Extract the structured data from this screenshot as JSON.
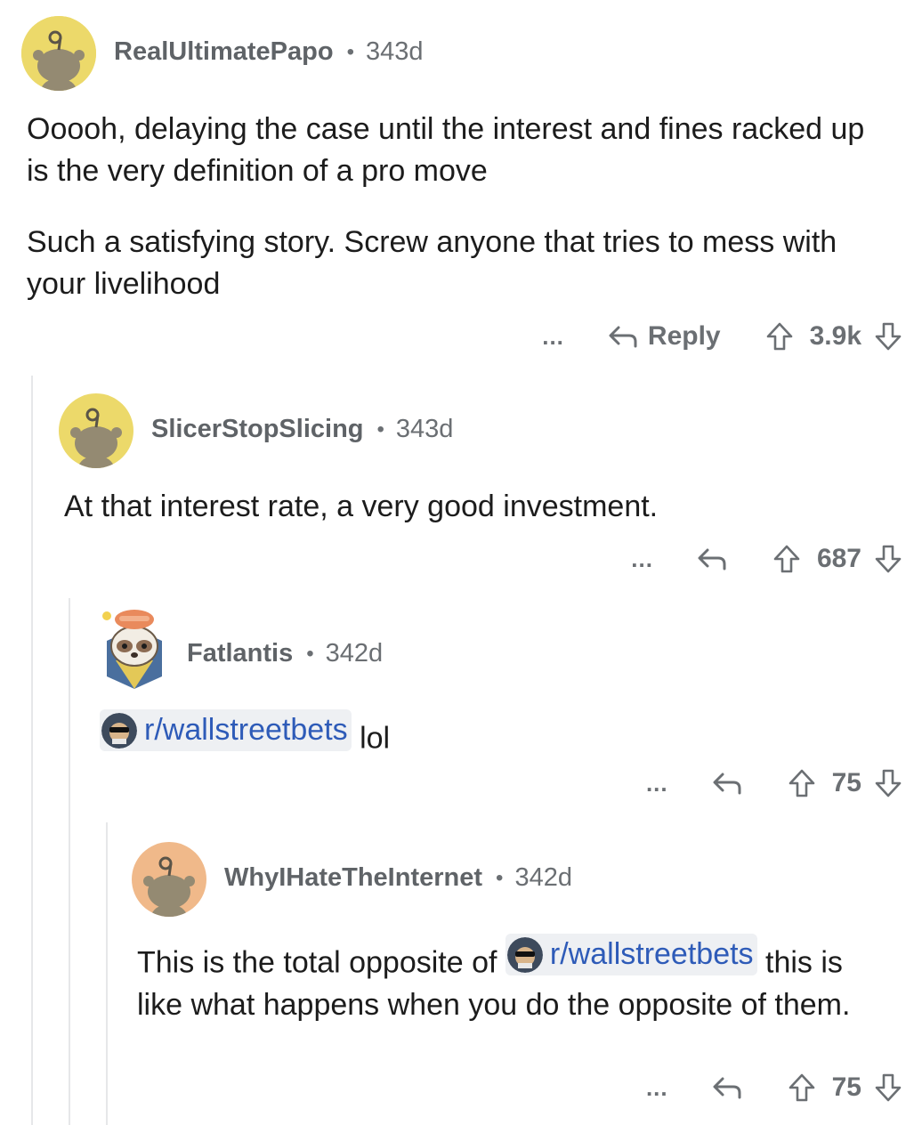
{
  "comments": [
    {
      "username": "RealUltimatePapo",
      "age": "343d",
      "paragraphs": [
        "Ooooh, delaying the case until the interest and fines racked up is the very definition of a pro move",
        "Such a satisfying story. Screw anyone that tries to mess with your livelihood"
      ],
      "more": "...",
      "reply_label": "Reply",
      "score": "3.9k"
    },
    {
      "username": "SlicerStopSlicing",
      "age": "343d",
      "text": "At that interest rate, a very good investment.",
      "more": "...",
      "score": "687"
    },
    {
      "username": "Fatlantis",
      "age": "342d",
      "subreddit_link": "r/wallstreetbets",
      "text_after": "lol",
      "more": "...",
      "score": "75"
    },
    {
      "username": "WhyIHateTheInternet",
      "age": "342d",
      "text_before": "This is the total opposite of",
      "subreddit_link": "r/wallstreetbets",
      "text_after": "this is like what happens when you do the opposite of them.",
      "more": "...",
      "score": "75"
    }
  ],
  "colors": {
    "avatar_yellow": "#ecd96a",
    "avatar_orange": "#f0b98a",
    "link": "#2e5bb8",
    "meta_gray": "#6b6f73"
  },
  "icons": [
    "snoo-avatar-icon",
    "sloth-avatar-icon",
    "wsb-subreddit-icon",
    "reply-arrow-icon",
    "upvote-icon",
    "downvote-icon"
  ]
}
